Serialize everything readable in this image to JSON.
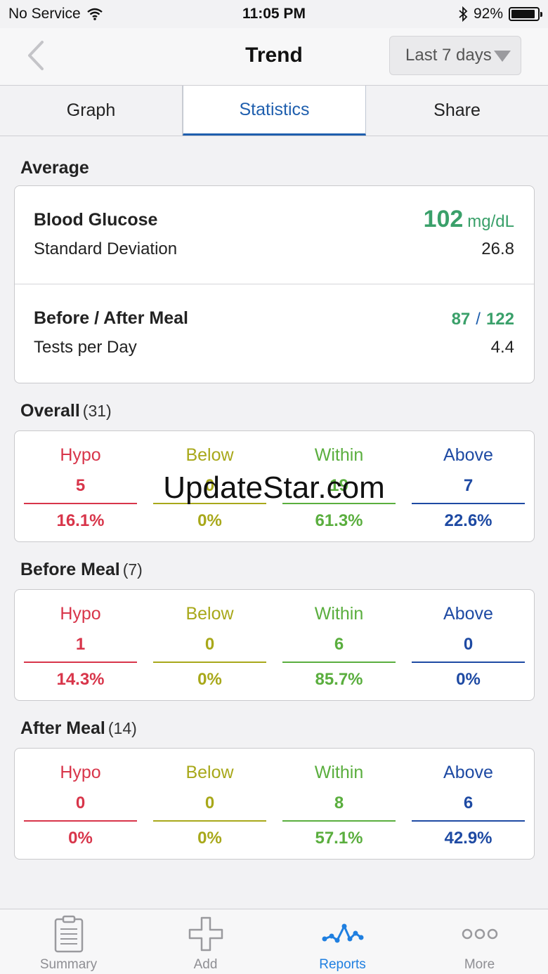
{
  "status_bar": {
    "carrier": "No Service",
    "time": "11:05 PM",
    "battery": "92%",
    "battery_level": 0.92
  },
  "nav": {
    "title": "Trend",
    "range": "Last 7 days"
  },
  "tabs": [
    {
      "label": "Graph",
      "active": false
    },
    {
      "label": "Statistics",
      "active": true
    },
    {
      "label": "Share",
      "active": false
    }
  ],
  "average": {
    "title": "Average",
    "glucose_label": "Blood Glucose",
    "glucose_value": "102",
    "glucose_unit": "mg/dL",
    "sd_label": "Standard Deviation",
    "sd_value": "26.8",
    "meal_label": "Before / After Meal",
    "before_value": "87",
    "slash": "/",
    "after_value": "122",
    "tests_label": "Tests per Day",
    "tests_value": "4.4"
  },
  "overall": {
    "title": "Overall",
    "count": "(31)",
    "cols": [
      {
        "label": "Hypo",
        "count": "5",
        "pct": "16.1%"
      },
      {
        "label": "Below",
        "count": "0",
        "pct": "0%"
      },
      {
        "label": "Within",
        "count": "19",
        "pct": "61.3%"
      },
      {
        "label": "Above",
        "count": "7",
        "pct": "22.6%"
      }
    ]
  },
  "before_meal": {
    "title": "Before Meal",
    "count": "(7)",
    "cols": [
      {
        "label": "Hypo",
        "count": "1",
        "pct": "14.3%"
      },
      {
        "label": "Below",
        "count": "0",
        "pct": "0%"
      },
      {
        "label": "Within",
        "count": "6",
        "pct": "85.7%"
      },
      {
        "label": "Above",
        "count": "0",
        "pct": "0%"
      }
    ]
  },
  "after_meal": {
    "title": "After Meal",
    "count": "(14)",
    "cols": [
      {
        "label": "Hypo",
        "count": "0",
        "pct": "0%"
      },
      {
        "label": "Below",
        "count": "0",
        "pct": "0%"
      },
      {
        "label": "Within",
        "count": "8",
        "pct": "57.1%"
      },
      {
        "label": "Above",
        "count": "6",
        "pct": "42.9%"
      }
    ]
  },
  "watermark": "UpdateStar.com",
  "tab_bar": [
    {
      "label": "Summary",
      "icon": "clipboard-icon"
    },
    {
      "label": "Add",
      "icon": "plus-icon"
    },
    {
      "label": "Reports",
      "icon": "chart-line-icon",
      "active": true
    },
    {
      "label": "More",
      "icon": "more-dots-icon"
    }
  ],
  "colors": {
    "hypo": "#d8354a",
    "below": "#a8a81a",
    "within": "#5aae3e",
    "above": "#1e4aa3",
    "accent": "#1f5fae",
    "glucose": "#3aa06a"
  }
}
